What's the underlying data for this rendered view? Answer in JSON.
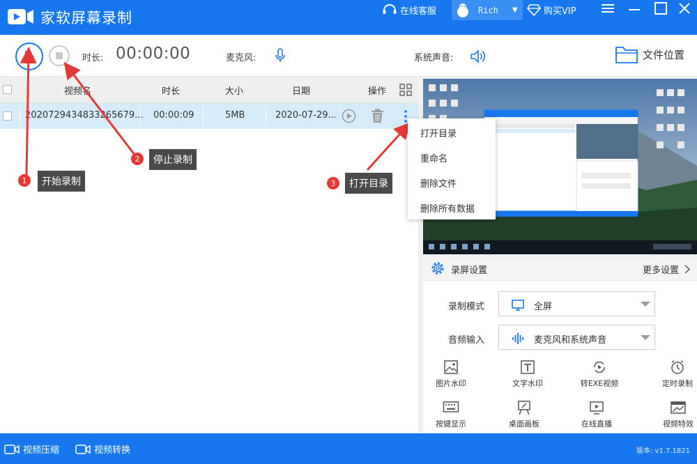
{
  "titlebar": {
    "app_title": "家软屏幕录制",
    "service_label": "在线客服",
    "username": "Rich",
    "vip_label": "购买VIP"
  },
  "toolbar": {
    "duration_label": "时长:",
    "duration_value": "00:00:00",
    "mic_label": "麦克风:",
    "system_sound_label": "系统声音:",
    "mic_volume": 1.0,
    "system_volume": 1.0,
    "file_location_label": "文件位置"
  },
  "table": {
    "headers": {
      "name": "视频名",
      "duration": "时长",
      "size": "大小",
      "date": "日期",
      "action": "操作"
    },
    "rows": [
      {
        "name": "202072943483326567​9...",
        "duration": "00:00:09",
        "size": "5MB",
        "date": "2020-07-29..."
      }
    ]
  },
  "context_menu": {
    "items": [
      "打开目录",
      "重命名",
      "删除文件",
      "删除所有数据"
    ]
  },
  "annotations": [
    {
      "number": "1",
      "text": "开始录制"
    },
    {
      "number": "2",
      "text": "停止录制"
    },
    {
      "number": "3",
      "text": "打开目录"
    }
  ],
  "settings": {
    "title": "录屏设置",
    "more_label": "更多设置",
    "record_mode_label": "录制模式",
    "record_mode_value": "全屏",
    "audio_input_label": "音频输入",
    "audio_input_value": "麦克风和系统声音",
    "tools": [
      {
        "label": "图片水印",
        "icon": "image-icon"
      },
      {
        "label": "文字水印",
        "icon": "text-icon"
      },
      {
        "label": "转EXE视频",
        "icon": "convert-icon"
      },
      {
        "label": "定时录制",
        "icon": "alarm-icon"
      },
      {
        "label": "按键显示",
        "icon": "keyboard-icon"
      },
      {
        "label": "桌面画板",
        "icon": "easel-icon"
      },
      {
        "label": "在线直播",
        "icon": "live-icon"
      },
      {
        "label": "视频特效",
        "icon": "effects-icon"
      }
    ]
  },
  "bottombar": {
    "compress_label": "视频压缩",
    "convert_label": "视频转换",
    "version": "版本: v1.7.1821"
  },
  "colors": {
    "brand_blue": "#1677ee",
    "row_selected": "#d7ecfa",
    "annotation_red": "#e53935",
    "callout_gray": "#4a4a4a"
  }
}
